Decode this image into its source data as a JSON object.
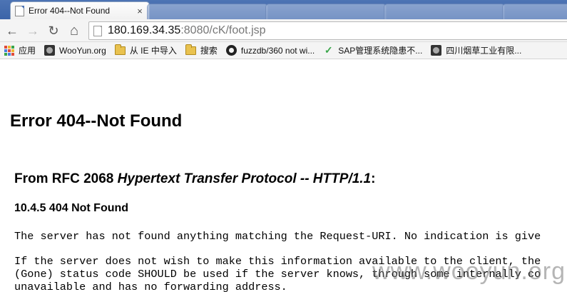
{
  "browser": {
    "active_tab": {
      "title": "Error 404--Not Found",
      "close": "×"
    },
    "nav": {
      "back": "←",
      "forward": "→",
      "reload": "↻",
      "home": "⌂"
    },
    "url": {
      "host": "180.169.34.35",
      "rest": ":8080/cK/foot.jsp"
    },
    "bookmarks": [
      {
        "label": "应用",
        "icon": "apps-grid-icon"
      },
      {
        "label": "WooYun.org",
        "icon": "site-photo-icon"
      },
      {
        "label": "从 IE 中导入",
        "icon": "folder-icon"
      },
      {
        "label": "搜索",
        "icon": "folder-icon"
      },
      {
        "label": "fuzzdb/360 not wi...",
        "icon": "github-icon"
      },
      {
        "label": "SAP管理系统隐患不...",
        "icon": "sap-check-icon"
      },
      {
        "label": "四川烟草工业有限...",
        "icon": "site-photo-icon"
      }
    ],
    "colors": {
      "tabstrip": "#4d74b4",
      "toolbar": "#f4f4f4"
    }
  },
  "page": {
    "title": "Error 404--Not Found",
    "rfc_prefix": "From RFC 2068 ",
    "rfc_italic": "Hypertext Transfer Protocol -- HTTP/1.1",
    "rfc_suffix": ":",
    "section": "10.4.5 404 Not Found",
    "para1": "The server has not found anything matching the Request-URI. No indication is give",
    "para2_line1": "If the server does not wish to make this information available to the client, the",
    "para2_line2": "(Gone) status code SHOULD be used if the server knows, through some internally co",
    "para2_line3": "unavailable and has no forwarding address.",
    "watermark": "www.wooyun.org"
  }
}
